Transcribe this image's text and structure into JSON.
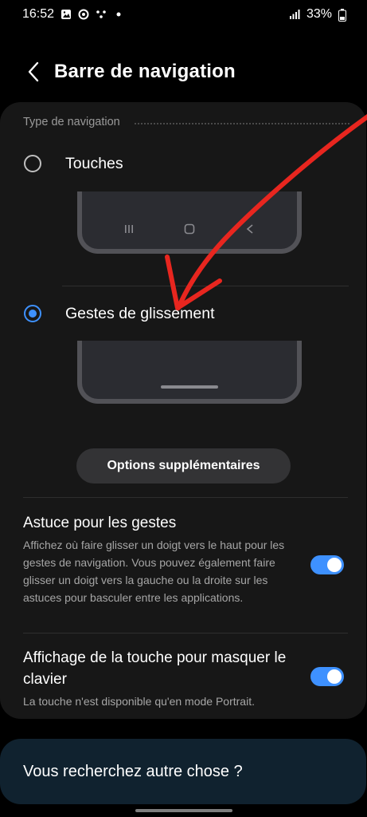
{
  "status_bar": {
    "time": "16:52",
    "battery": "33%"
  },
  "header": {
    "title": "Barre de navigation"
  },
  "navigation_type": {
    "section_title": "Type de navigation",
    "options": [
      {
        "label": "Touches",
        "selected": false
      },
      {
        "label": "Gestes de glissement",
        "selected": true
      }
    ]
  },
  "more_options_label": "Options supplémentaires",
  "settings": [
    {
      "title": "Astuce pour les gestes",
      "description": "Affichez où faire glisser un doigt vers le haut pour les gestes de navigation. Vous pouvez également faire glisser un doigt vers la gauche ou la droite sur les astuces pour basculer entre les applications.",
      "enabled": true
    },
    {
      "title": "Affichage de la touche pour masquer le clavier",
      "description": "La touche n'est disponible qu'en mode Portrait.",
      "enabled": true
    }
  ],
  "search_prompt": "Vous recherchez autre chose ?",
  "colors": {
    "accent": "#3e91ff",
    "annotation": "#e8261f",
    "card": "#171717",
    "search_card": "#10222f"
  },
  "icons": {
    "status": [
      "gallery-icon",
      "sync-icon",
      "dots-icon",
      "notification-dot-icon",
      "signal-icon",
      "battery-icon"
    ],
    "back": "chevron-left-icon",
    "nav_keys": [
      "recents-icon",
      "home-icon",
      "back-key-icon"
    ]
  }
}
